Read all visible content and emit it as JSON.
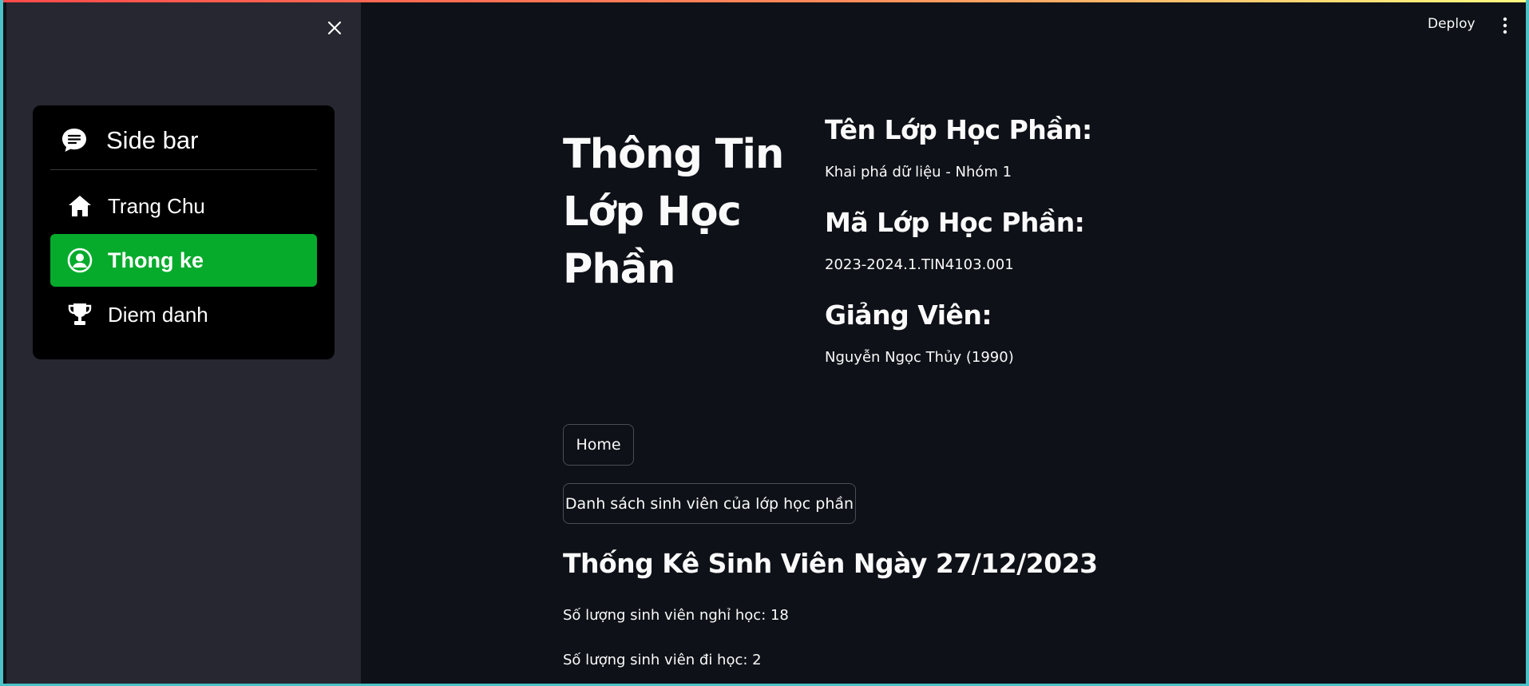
{
  "sidebar": {
    "menu": {
      "title": "Side bar",
      "title_icon": "chat-bubble-icon",
      "items": [
        {
          "label": "Trang Chu",
          "icon": "house-icon",
          "active": false
        },
        {
          "label": "Thong ke",
          "icon": "user-circle-icon",
          "active": true
        },
        {
          "label": "Diem danh",
          "icon": "trophy-icon",
          "active": false
        }
      ],
      "active_color": "#06ab2c"
    }
  },
  "header": {
    "deploy_label": "Deploy"
  },
  "main": {
    "page_title": "Thông Tin Lớp Học Phần",
    "class_name_heading": "Tên Lớp Học Phần:",
    "class_name_value": "Khai phá dữ liệu - Nhóm 1",
    "class_code_heading": "Mã Lớp Học Phần:",
    "class_code_value": "2023-2024.1.TIN4103.001",
    "lecturer_heading": "Giảng Viên:",
    "lecturer_value": "Nguyễn Ngọc Thủy (1990)",
    "home_button": "Home",
    "student_list_button": "Danh sách sinh viên của lớp học phần",
    "stats_heading": "Thống Kê Sinh Viên Ngày 27/12/2023",
    "absent_text": "Số lượng sinh viên nghỉ học: 18",
    "present_text": "Số lượng sinh viên đi học: 2"
  },
  "colors": {
    "background": "#0e1117",
    "sidebar": "#262730",
    "accent_green": "#06ab2c",
    "frame_border": "#4cc1c7"
  }
}
